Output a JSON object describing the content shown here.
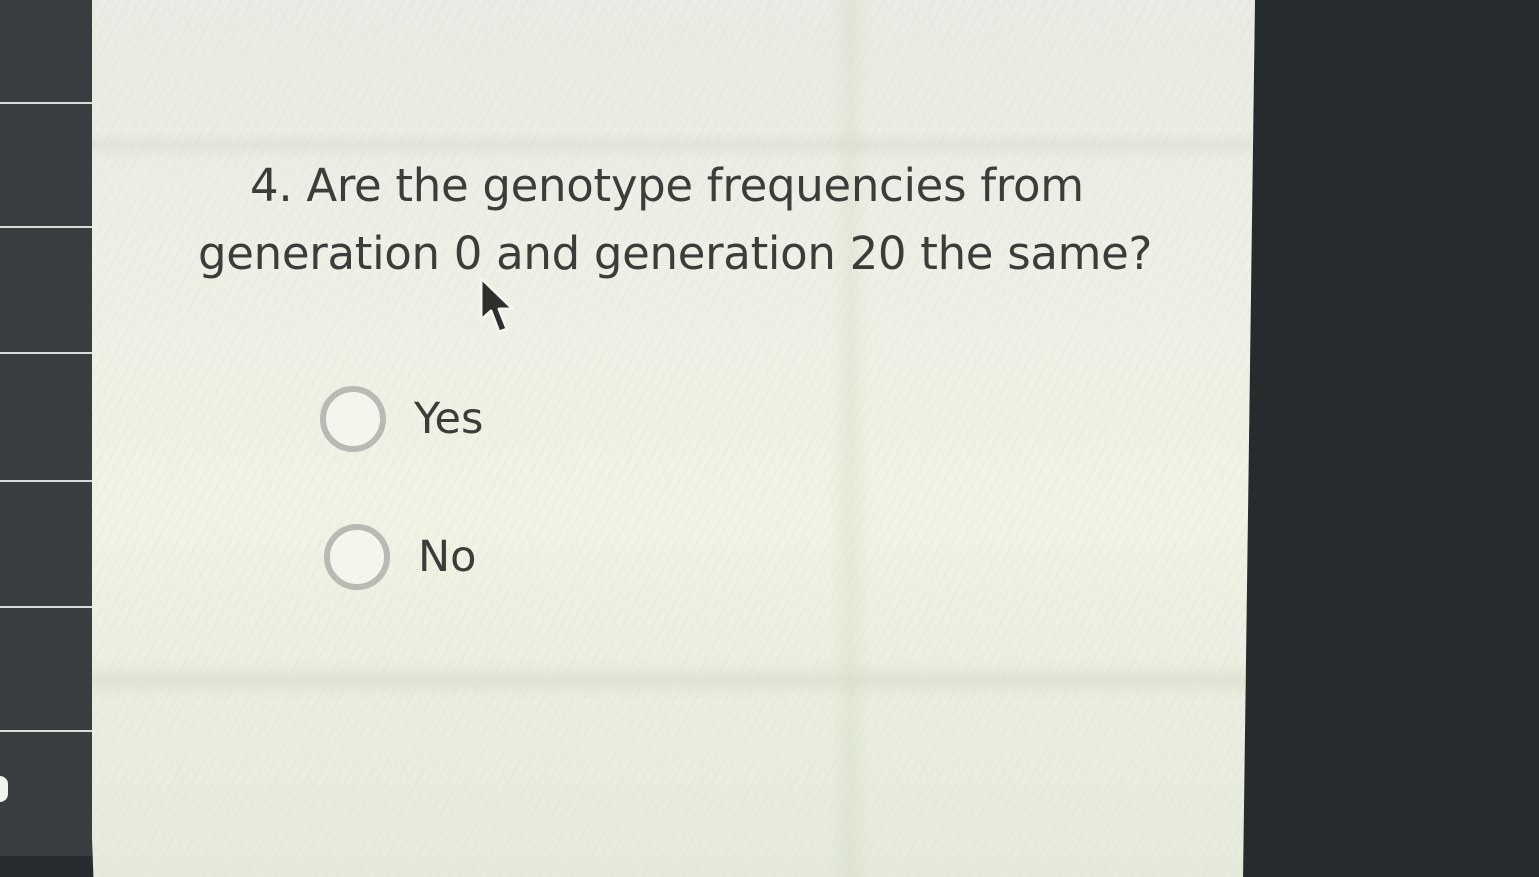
{
  "question": {
    "number_and_line1": "4. Are the genotype frequencies from",
    "line2": "generation 0 and generation 20 the same?"
  },
  "options": [
    {
      "label": "Yes",
      "selected": false
    },
    {
      "label": "No",
      "selected": false
    }
  ],
  "icons": {
    "cursor": "mouse-pointer-icon"
  },
  "colors": {
    "text": "#3c3d3a",
    "radio_border": "#b9bab3",
    "nav": "#3a3d40",
    "bezel": "#262b2e"
  }
}
